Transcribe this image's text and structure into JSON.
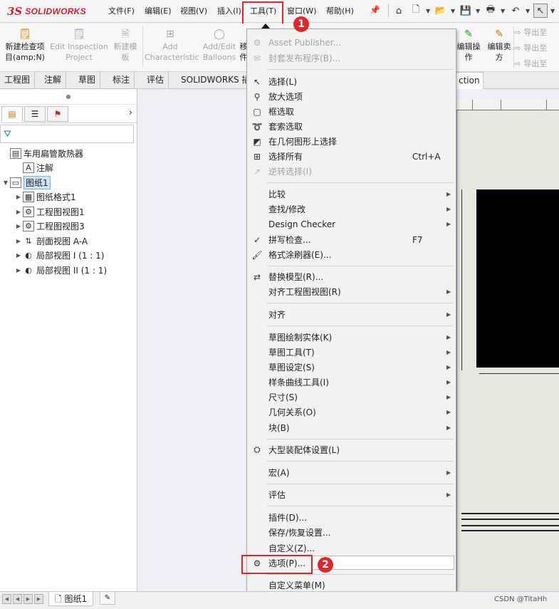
{
  "app": {
    "logo_prefix": "3S",
    "logo_text": "SOLIDWORKS"
  },
  "menubar": [
    {
      "label": "文件(F)"
    },
    {
      "label": "编辑(E)"
    },
    {
      "label": "视图(V)"
    },
    {
      "label": "插入(I)"
    },
    {
      "label": "工具(T)"
    },
    {
      "label": "窗口(W)"
    },
    {
      "label": "帮助(H)"
    }
  ],
  "ribbon": {
    "buttons": [
      {
        "label1": "新建检查项",
        "label2": "目(amp;N)",
        "enabled": true
      },
      {
        "label1": "Edit Inspection",
        "label2": "Project",
        "enabled": false
      },
      {
        "label1": "新建模",
        "label2": "板",
        "enabled": false
      },
      {
        "label1": "Add",
        "label2": "Characteristic",
        "enabled": false
      },
      {
        "label1": "Add/Edit",
        "label2": "Balloons",
        "enabled": false
      },
      {
        "label1": "移",
        "label2": "件",
        "enabled": true
      },
      {
        "label1": "编辑操",
        "label2": "作",
        "enabled": true
      },
      {
        "label1": "编辑卖",
        "label2": "方",
        "enabled": true
      }
    ],
    "export_items": [
      "导出至",
      "导出至",
      "导出至"
    ]
  },
  "tabs": [
    {
      "label": "工程图"
    },
    {
      "label": "注解"
    },
    {
      "label": "草图"
    },
    {
      "label": "标注"
    },
    {
      "label": "评估"
    },
    {
      "label": "SOLIDWORKS 插"
    }
  ],
  "tab_right": "ction",
  "feature_tree": [
    {
      "label": "车用扁管散热器",
      "level": 0,
      "expander": "",
      "icon": "drawing-icon"
    },
    {
      "label": "注解",
      "level": 1,
      "expander": "",
      "icon": "annotation-icon"
    },
    {
      "label": "图纸1",
      "level": 0,
      "expander": "▼",
      "icon": "sheet-icon",
      "selected": true
    },
    {
      "label": "图纸格式1",
      "level": 1,
      "expander": "▶",
      "icon": "sheet-format-icon"
    },
    {
      "label": "工程图视图1",
      "level": 1,
      "expander": "▶",
      "icon": "drawing-view-icon"
    },
    {
      "label": "工程图视图3",
      "level": 1,
      "expander": "▶",
      "icon": "drawing-view-icon"
    },
    {
      "label": "剖面视图 A-A",
      "level": 1,
      "expander": "▶",
      "icon": "section-view-icon"
    },
    {
      "label": "局部视图 I (1 : 1)",
      "level": 1,
      "expander": "▶",
      "icon": "detail-view-icon"
    },
    {
      "label": "局部视图 II (1 : 1)",
      "level": 1,
      "expander": "▶",
      "icon": "detail-view-icon"
    }
  ],
  "tools_menu": {
    "items": [
      {
        "label": "Asset Publisher...",
        "shortcut": "",
        "submenu": false,
        "enabled": false,
        "icon": "asset-publisher-icon"
      },
      {
        "label": "封套发布程序(B)...",
        "shortcut": "",
        "submenu": false,
        "enabled": false,
        "icon": "envelope-publisher-icon"
      },
      {
        "sep": true
      },
      {
        "label": "选择(L)",
        "shortcut": "",
        "submenu": false,
        "enabled": true,
        "icon": "select-cursor-icon"
      },
      {
        "label": "放大选项",
        "shortcut": "",
        "submenu": false,
        "enabled": true,
        "icon": "magnify-icon"
      },
      {
        "label": "框选取",
        "shortcut": "",
        "submenu": false,
        "enabled": true,
        "icon": "box-select-icon"
      },
      {
        "label": "套索选取",
        "shortcut": "",
        "submenu": false,
        "enabled": true,
        "icon": "lasso-select-icon"
      },
      {
        "label": "在几何图形上选择",
        "shortcut": "",
        "submenu": false,
        "enabled": true,
        "icon": "geometry-select-icon"
      },
      {
        "label": "选择所有",
        "shortcut": "Ctrl+A",
        "submenu": false,
        "enabled": true,
        "icon": "select-all-icon"
      },
      {
        "label": "逆转选择(I)",
        "shortcut": "",
        "submenu": false,
        "enabled": false,
        "icon": "invert-select-icon"
      },
      {
        "sep": true
      },
      {
        "label": "比较",
        "shortcut": "",
        "submenu": true,
        "enabled": true,
        "icon": ""
      },
      {
        "label": "查找/修改",
        "shortcut": "",
        "submenu": true,
        "enabled": true,
        "icon": ""
      },
      {
        "label": "Design Checker",
        "shortcut": "",
        "submenu": true,
        "enabled": true,
        "icon": ""
      },
      {
        "label": "拼写检查...",
        "shortcut": "F7",
        "submenu": false,
        "enabled": true,
        "icon": "spell-check-icon"
      },
      {
        "label": "格式涂刷器(E)...",
        "shortcut": "",
        "submenu": false,
        "enabled": true,
        "icon": "format-painter-icon"
      },
      {
        "sep": true
      },
      {
        "label": "替换模型(R)...",
        "shortcut": "",
        "submenu": false,
        "enabled": true,
        "icon": "replace-model-icon"
      },
      {
        "label": "对齐工程图视图(R)",
        "shortcut": "",
        "submenu": true,
        "enabled": true,
        "icon": ""
      },
      {
        "sep": true
      },
      {
        "label": "对齐",
        "shortcut": "",
        "submenu": true,
        "enabled": true,
        "icon": ""
      },
      {
        "sep": true
      },
      {
        "label": "草图绘制实体(K)",
        "shortcut": "",
        "submenu": true,
        "enabled": true,
        "icon": ""
      },
      {
        "label": "草图工具(T)",
        "shortcut": "",
        "submenu": true,
        "enabled": true,
        "icon": ""
      },
      {
        "label": "草图设定(S)",
        "shortcut": "",
        "submenu": true,
        "enabled": true,
        "icon": ""
      },
      {
        "label": "样条曲线工具(I)",
        "shortcut": "",
        "submenu": true,
        "enabled": true,
        "icon": ""
      },
      {
        "label": "尺寸(S)",
        "shortcut": "",
        "submenu": true,
        "enabled": true,
        "icon": ""
      },
      {
        "label": "几何关系(O)",
        "shortcut": "",
        "submenu": true,
        "enabled": true,
        "icon": ""
      },
      {
        "label": "块(B)",
        "shortcut": "",
        "submenu": true,
        "enabled": true,
        "icon": ""
      },
      {
        "sep": true
      },
      {
        "label": "大型装配体设置(L)",
        "shortcut": "",
        "submenu": false,
        "enabled": true,
        "icon": "large-assembly-icon"
      },
      {
        "sep": true
      },
      {
        "label": "宏(A)",
        "shortcut": "",
        "submenu": true,
        "enabled": true,
        "icon": ""
      },
      {
        "sep": true
      },
      {
        "label": "评估",
        "shortcut": "",
        "submenu": true,
        "enabled": true,
        "icon": ""
      },
      {
        "sep": true
      },
      {
        "label": "插件(D)...",
        "shortcut": "",
        "submenu": false,
        "enabled": true,
        "icon": ""
      },
      {
        "label": "保存/恢复设置...",
        "shortcut": "",
        "submenu": false,
        "enabled": true,
        "icon": ""
      },
      {
        "label": "自定义(Z)...",
        "shortcut": "",
        "submenu": false,
        "enabled": true,
        "icon": ""
      },
      {
        "label": "选项(P)...",
        "shortcut": "",
        "submenu": false,
        "enabled": true,
        "icon": "gear-icon",
        "highlighted": true
      },
      {
        "sep": true
      },
      {
        "label": "自定义菜单(M)",
        "shortcut": "",
        "submenu": false,
        "enabled": true,
        "icon": ""
      }
    ]
  },
  "annotations": {
    "badge_1": "1",
    "badge_2": "2"
  },
  "bottom": {
    "sheet_tab": "图纸1",
    "watermark": "CSDN @TitaHh"
  },
  "colors": {
    "accent_red": "#e0262d",
    "select_blue": "#cde3f7"
  }
}
